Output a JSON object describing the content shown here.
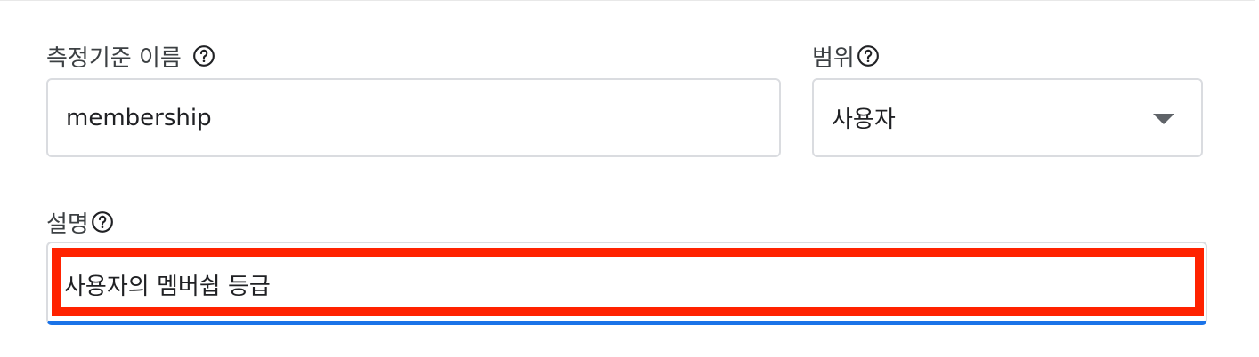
{
  "metric_name": {
    "label": "측정기준 이름",
    "value": "membership",
    "help_icon": "help-circle-icon"
  },
  "scope": {
    "label": "범위",
    "selected": "사용자",
    "help_icon": "help-circle-icon",
    "arrow_icon": "dropdown-arrow-icon"
  },
  "description": {
    "label": "설명",
    "value": "사용자의 멤버쉽 등급",
    "help_icon": "help-circle-icon"
  },
  "colors": {
    "highlight": "#ff2200",
    "focus": "#1a73e8",
    "border": "#dadce0"
  }
}
